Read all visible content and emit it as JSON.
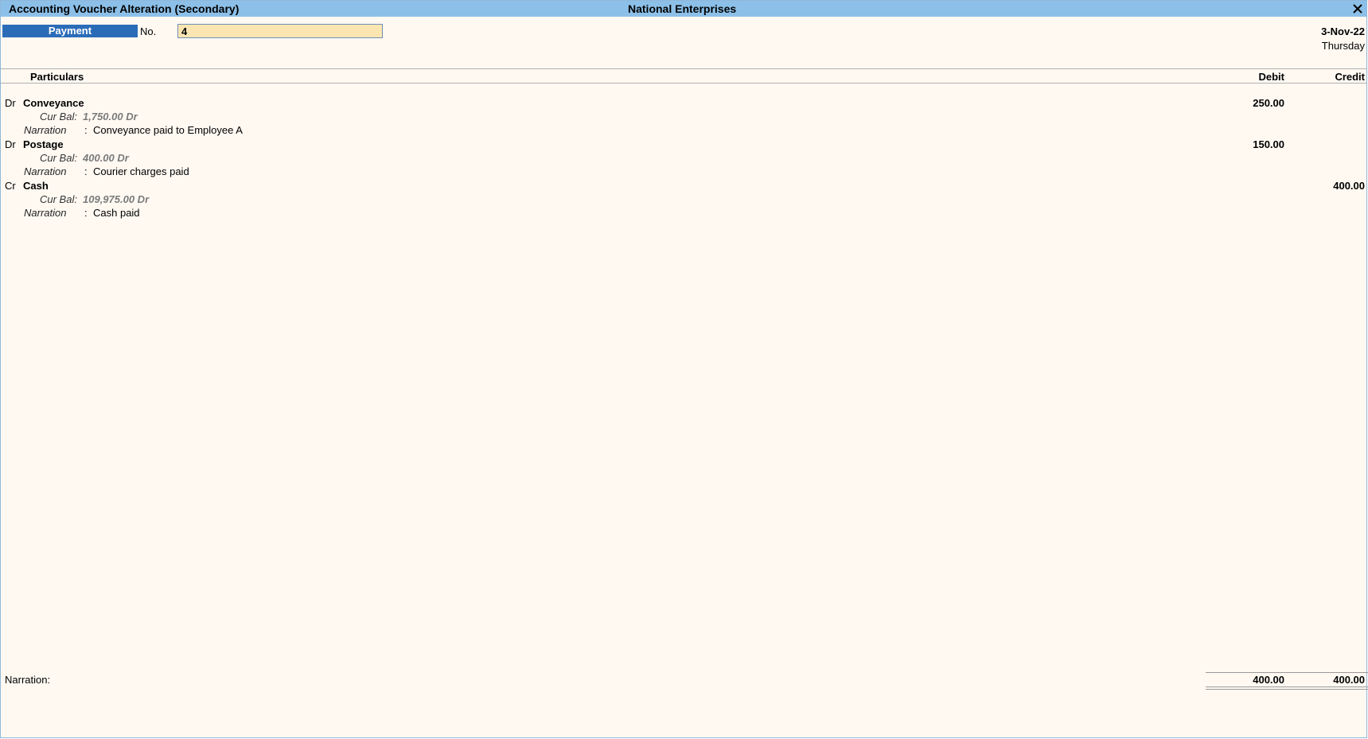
{
  "window": {
    "title": "Accounting Voucher Alteration (Secondary)",
    "company": "National Enterprises",
    "close_icon": "close-icon"
  },
  "voucher": {
    "type": "Payment",
    "no_label": "No.",
    "no_value": "4",
    "date": "3-Nov-22",
    "day": "Thursday"
  },
  "columns": {
    "particulars": "Particulars",
    "debit": "Debit",
    "credit": "Credit"
  },
  "entries": [
    {
      "drcr": "Dr",
      "ledger": "Conveyance",
      "debit": "250.00",
      "credit": "",
      "curbal_label": "Cur Bal:",
      "curbal_value": "1,750.00 Dr",
      "narration_label": "Narration",
      "narration_colon": ":",
      "narration": "Conveyance paid to Employee A"
    },
    {
      "drcr": "Dr",
      "ledger": "Postage",
      "debit": "150.00",
      "credit": "",
      "curbal_label": "Cur Bal:",
      "curbal_value": "400.00 Dr",
      "narration_label": "Narration",
      "narration_colon": ":",
      "narration": "Courier charges paid"
    },
    {
      "drcr": "Cr",
      "ledger": "Cash",
      "debit": "",
      "credit": "400.00",
      "curbal_label": "Cur Bal:",
      "curbal_value": "109,975.00 Dr",
      "narration_label": "Narration",
      "narration_colon": ":",
      "narration": "Cash paid"
    }
  ],
  "footer": {
    "narration_label": "Narration:",
    "total_debit": "400.00",
    "total_credit": "400.00"
  },
  "colors": {
    "titlebar": "#8cc0e8",
    "voucher_type_bg": "#2b6cb8",
    "input_bg": "#fbe6b2",
    "page_bg": "#fff9f2"
  }
}
